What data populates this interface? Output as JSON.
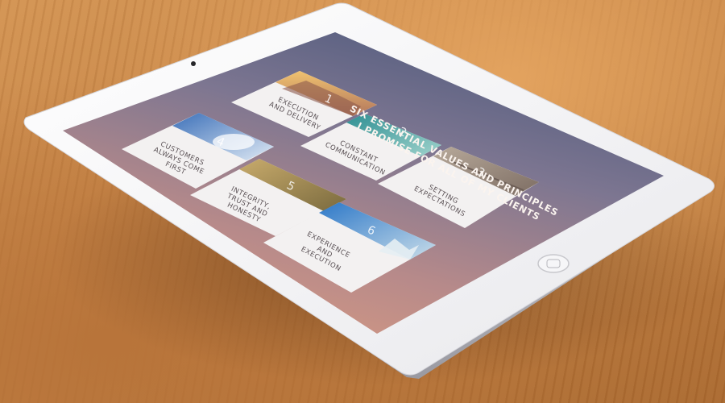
{
  "screen": {
    "headline_lines": [
      "SIX ESSENTIAL VALUES AND PRINCIPLES",
      "I PROMISE FOR ALL OF MY CLIENTS"
    ]
  },
  "cards": [
    {
      "number": "1",
      "label_lines": [
        "EXECUTION",
        "AND DELIVERY"
      ]
    },
    {
      "number": "2",
      "label_lines": [
        "CONSTANT",
        "COMMUNICATION"
      ]
    },
    {
      "number": "3",
      "label_lines": [
        "SETTING",
        "EXPECTATIONS"
      ]
    },
    {
      "number": "4",
      "label_lines": [
        "CUSTOMERS",
        "ALWAYS COME",
        "FIRST"
      ]
    },
    {
      "number": "5",
      "label_lines": [
        "INTEGRITY,",
        "TRUST AND",
        "HONESTY"
      ]
    },
    {
      "number": "6",
      "label_lines": [
        "EXPERIENCE",
        "AND",
        "EXECUTION"
      ]
    }
  ],
  "colors": {
    "table_wood": "#c48244",
    "tablet_bezel": "#f4f4f6",
    "screen_top": "#58607e",
    "screen_bottom": "#c58b7b",
    "card_background": "#f3f1f1",
    "label_text": "#5a5155",
    "headline_text": "#fbf4ef"
  },
  "icons": {
    "camera": "front-camera-icon",
    "home": "home-button-icon"
  }
}
